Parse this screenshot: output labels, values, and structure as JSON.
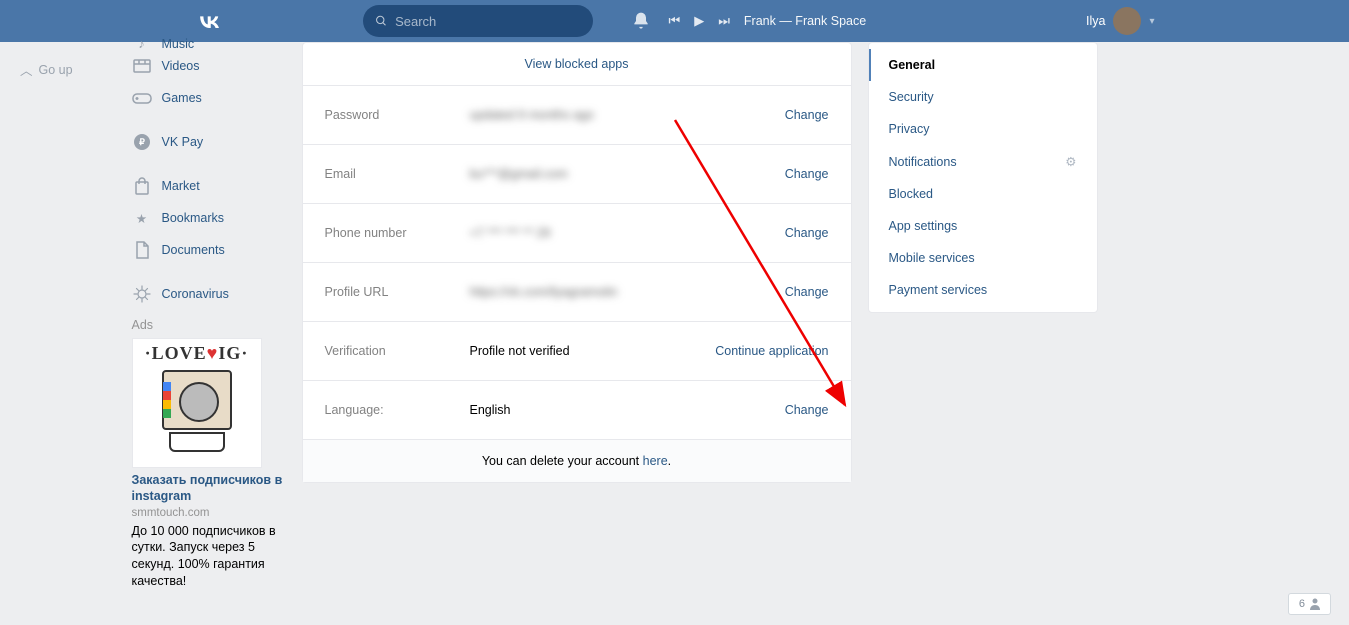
{
  "header": {
    "search_placeholder": "Search",
    "track": "Frank — Frank Space",
    "username": "Ilya"
  },
  "goup": "Go up",
  "sidebar": {
    "items": [
      {
        "key": "music",
        "label": "Music"
      },
      {
        "key": "videos",
        "label": "Videos"
      },
      {
        "key": "games",
        "label": "Games"
      },
      {
        "key": "vkpay",
        "label": "VK Pay"
      },
      {
        "key": "market",
        "label": "Market"
      },
      {
        "key": "bookmarks",
        "label": "Bookmarks"
      },
      {
        "key": "documents",
        "label": "Documents"
      },
      {
        "key": "corona",
        "label": "Coronavirus"
      }
    ],
    "ads_label": "Ads",
    "ad": {
      "title": "Заказать подписчиков в instagram",
      "domain": "smmtouch.com",
      "desc": "До 10 000 подписчиков в сутки. Запуск через 5 секунд. 100% гарантия качества!",
      "imgtext": "LOVE♥IG"
    }
  },
  "settings": {
    "blocked": "View blocked apps",
    "rows": {
      "password": {
        "label": "Password",
        "value": "updated 9 months ago",
        "action": "Change"
      },
      "email": {
        "label": "Email",
        "value": "bu***@gmail.com",
        "action": "Change"
      },
      "phone": {
        "label": "Phone number",
        "value": "+7 *** *** ** 29",
        "action": "Change"
      },
      "url": {
        "label": "Profile URL",
        "value": "https://vk.com/ilyagramotin",
        "action": "Change"
      },
      "verif": {
        "label": "Verification",
        "value": "Profile not verified",
        "action": "Continue application"
      },
      "lang": {
        "label": "Language:",
        "value": "English",
        "action": "Change"
      }
    },
    "delete_prefix": "You can delete your account ",
    "delete_link": "here"
  },
  "tabs": {
    "general": "General",
    "security": "Security",
    "privacy": "Privacy",
    "notifications": "Notifications",
    "blocked": "Blocked",
    "app": "App settings",
    "mobile": "Mobile services",
    "payment": "Payment services"
  },
  "counter": "6"
}
